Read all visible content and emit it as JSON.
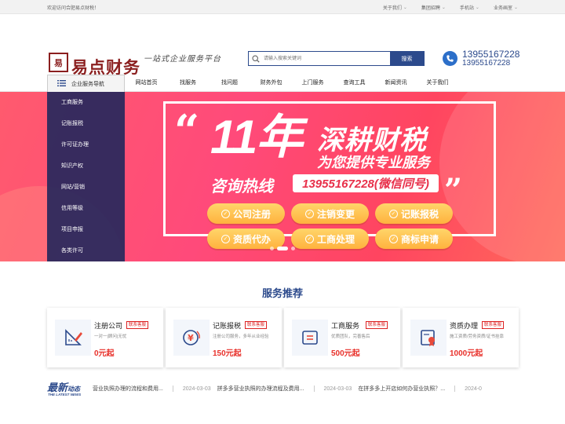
{
  "topbar": {
    "welcome": "欢迎访问合肥易点财税！",
    "links": [
      "关于我们",
      "集团招聘",
      "手机站",
      "业务画室"
    ]
  },
  "header": {
    "logo_mark": "易",
    "logo_text": "易点财务",
    "slogan": "一站式企业服务平台",
    "search_placeholder": "请输入搜索关键词",
    "search_button": "搜索",
    "phone1": "13955167228",
    "phone2": "13955167228"
  },
  "nav": {
    "category_label": "企业服务导航",
    "items": [
      "网站首页",
      "找服务",
      "找问题",
      "财务外包",
      "上门服务",
      "查询工具",
      "新闻资讯",
      "关于我们"
    ]
  },
  "sidemenu": [
    "工商服务",
    "记账报税",
    "许可证办理",
    "知识产权",
    "网站/营销",
    "信用等级",
    "项目申报",
    "各类许可"
  ],
  "banner": {
    "quote_open": "“",
    "quote_close": "”",
    "years": "11年",
    "deep": "深耕财税",
    "provide": "为您提供专业服务",
    "hotline_label": "咨询热线",
    "hotline": "13955167228(微信同号)",
    "pills": [
      "公司注册",
      "注销变更",
      "记账报税",
      "资质代办",
      "工商处理",
      "商标申请"
    ]
  },
  "services": {
    "title": "服务推荐",
    "badge": "联系客服",
    "cards": [
      {
        "name": "注册公司",
        "desc": "一对一|顾问|无忧",
        "price": "0元起",
        "icon": "pen-ruler-icon"
      },
      {
        "name": "记账报税",
        "desc": "注册公司服务，多年从业经验",
        "price": "150元起",
        "icon": "yen-coin-icon"
      },
      {
        "name": "工商服务",
        "desc": "优质团队，完善售后",
        "price": "500元起",
        "icon": "document-icon"
      },
      {
        "name": "资质办理",
        "desc": "施工资质/劳务资质/证书挂靠",
        "price": "1000元起",
        "icon": "certificate-icon"
      }
    ]
  },
  "news": {
    "logo_main": "最新",
    "logo_sub": "动态",
    "logo_en": "THE LATEST NEWS",
    "items": [
      {
        "date": "",
        "title": "营业执照办理的流程和费用..."
      },
      {
        "date": "2024-03-03",
        "title": "拼多多营业执照的办理流程及费用..."
      },
      {
        "date": "2024-03-03",
        "title": "在拼多多上开店如何办营业执照？..."
      },
      {
        "date": "2024-0",
        "title": ""
      }
    ]
  },
  "colors": {
    "brand": "#8b1f1f",
    "primary": "#2c4a8c",
    "price": "#e8302a",
    "pill": "#ffb23e"
  }
}
